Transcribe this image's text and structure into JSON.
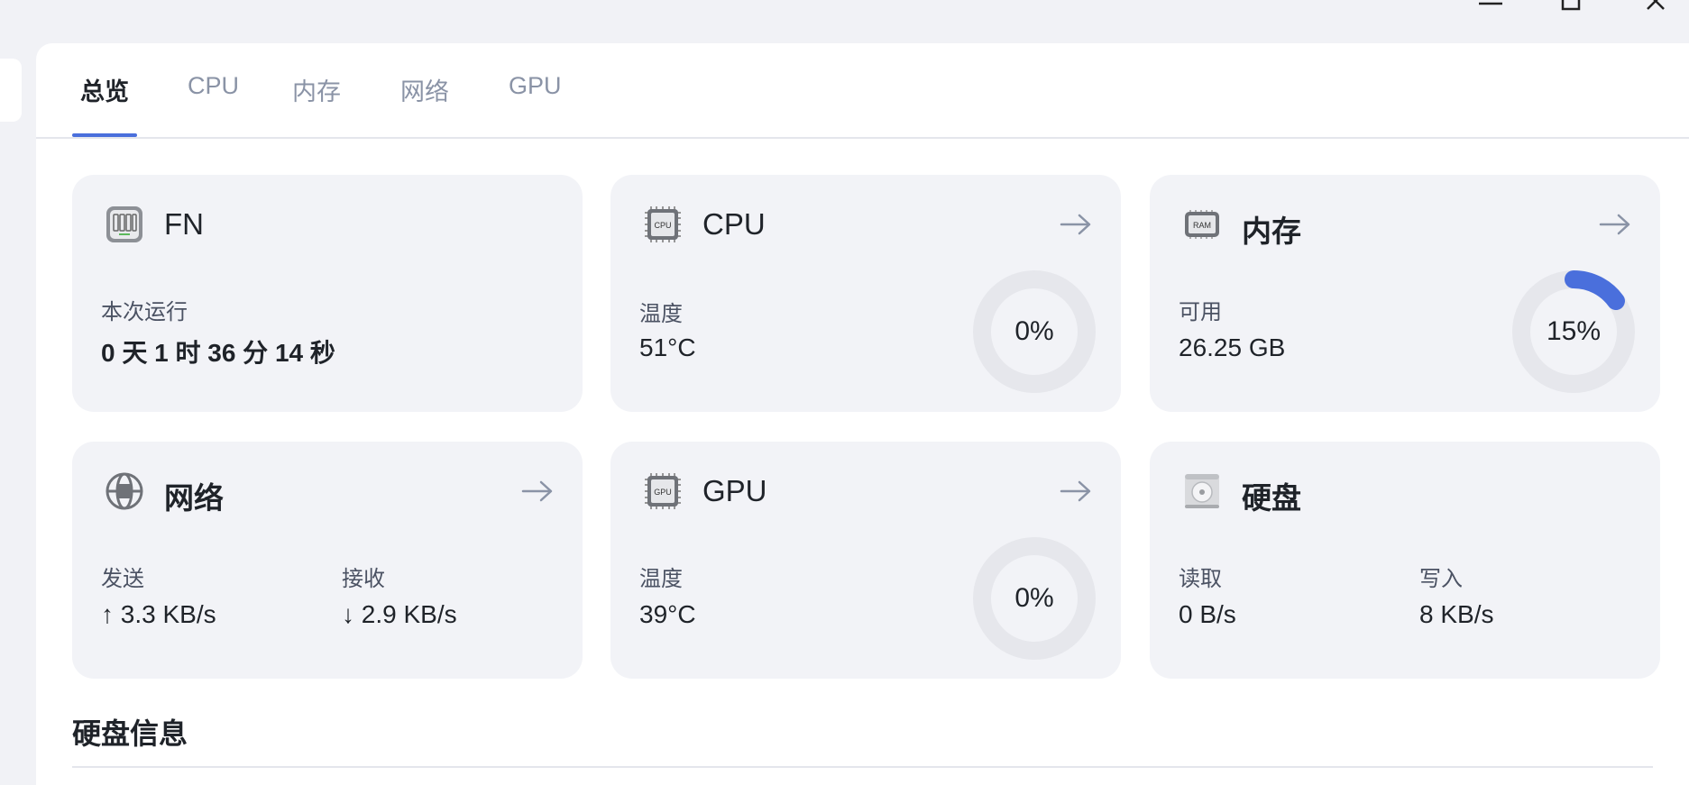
{
  "window": {
    "controls": [
      "minimize-icon",
      "maximize-icon",
      "close-icon"
    ]
  },
  "tabs": [
    {
      "label": "总览",
      "active": true
    },
    {
      "label": "CPU"
    },
    {
      "label": "内存"
    },
    {
      "label": "网络"
    },
    {
      "label": "GPU"
    }
  ],
  "cards": {
    "fn": {
      "title": "FN",
      "uptime_label": "本次运行",
      "uptime_value": "0 天 1 时 36 分 14 秒",
      "icon": "nas-icon"
    },
    "cpu": {
      "title": "CPU",
      "temp_label": "温度",
      "temp_value": "51°C",
      "usage_text": "0%",
      "usage_fraction": 0.0,
      "icon": "cpu-chip-icon"
    },
    "memory": {
      "title": "内存",
      "avail_label": "可用",
      "avail_value": "26.25 GB",
      "usage_text": "15%",
      "usage_fraction": 0.15,
      "icon": "ram-icon"
    },
    "network": {
      "title": "网络",
      "send_label": "发送",
      "send_value": "↑ 3.3 KB/s",
      "recv_label": "接收",
      "recv_value": "↓ 2.9 KB/s",
      "icon": "globe-icon"
    },
    "gpu": {
      "title": "GPU",
      "temp_label": "温度",
      "temp_value": "39°C",
      "usage_text": "0%",
      "usage_fraction": 0.0,
      "icon": "gpu-chip-icon"
    },
    "disk": {
      "title": "硬盘",
      "read_label": "读取",
      "read_value": "0 B/s",
      "write_label": "写入",
      "write_value": "8 KB/s",
      "icon": "hard-drive-icon"
    }
  },
  "section": {
    "title": "硬盘信息"
  },
  "colors": {
    "accent": "#4a6fdc",
    "card_bg": "#f2f3f7",
    "ring_track": "#e6e7ec"
  }
}
